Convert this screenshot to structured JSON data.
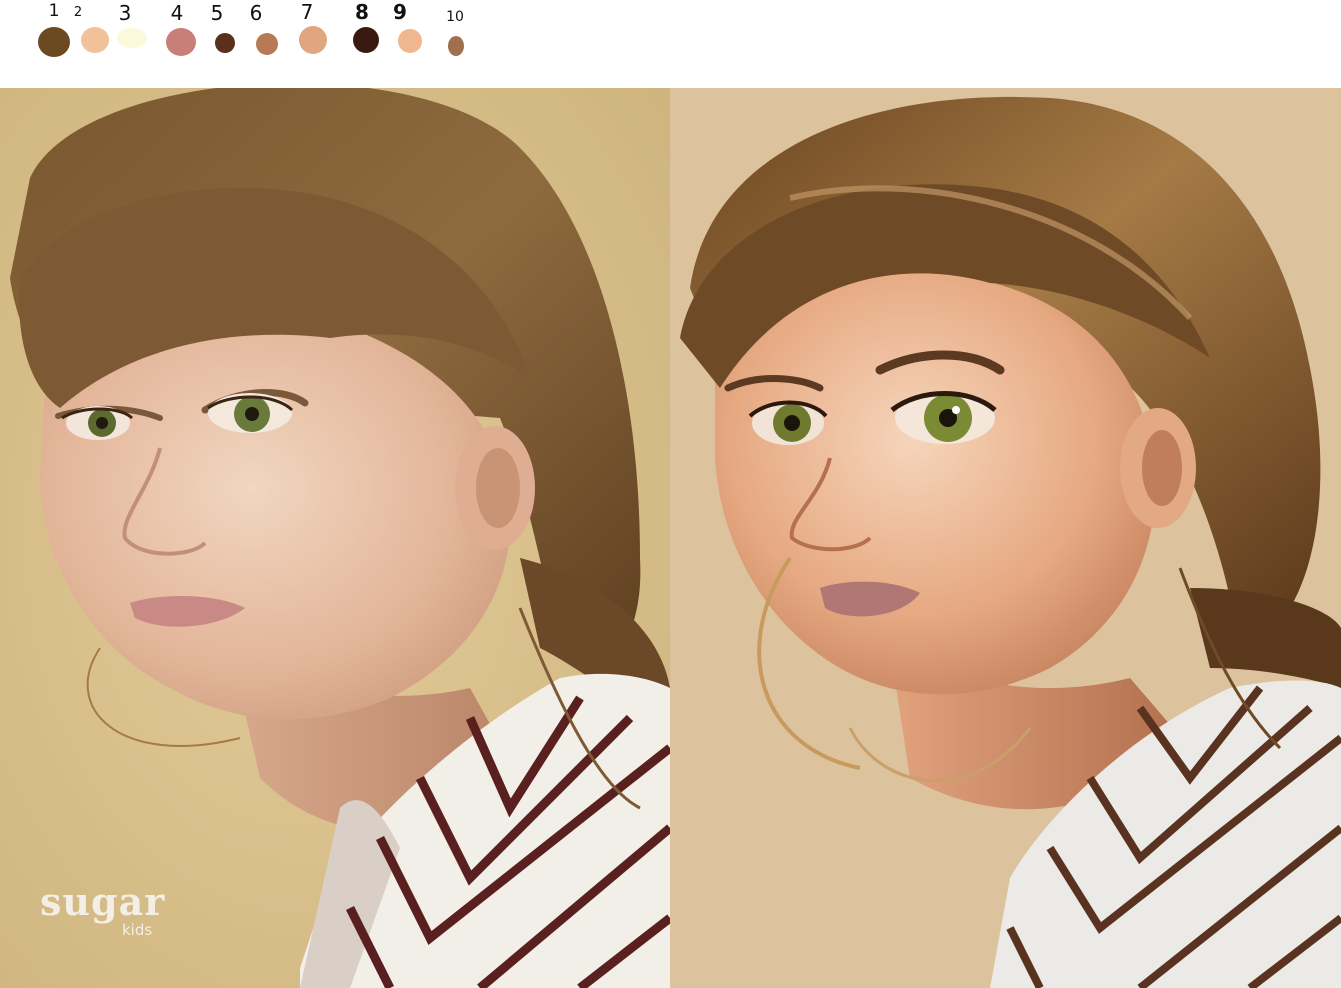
{
  "palette": {
    "swatches": [
      {
        "number": "1",
        "color": "#6b4a22"
      },
      {
        "number": "2",
        "color": "#f1c29a"
      },
      {
        "number": "3",
        "color": "#fbf8dc"
      },
      {
        "number": "4",
        "color": "#c77f78"
      },
      {
        "number": "5",
        "color": "#5a2f1c"
      },
      {
        "number": "6",
        "color": "#b87a55"
      },
      {
        "number": "7",
        "color": "#dfa680"
      },
      {
        "number": "8",
        "color": "#3a1a10"
      },
      {
        "number": "9",
        "color": "#f0b68e"
      },
      {
        "number": "10",
        "color": "#a0704e"
      }
    ]
  },
  "photo": {
    "background_color": "#d9c28f",
    "watermark": {
      "brand": "sugar",
      "sub": "kids"
    }
  },
  "painting": {
    "background_color": "#dcc39d"
  }
}
